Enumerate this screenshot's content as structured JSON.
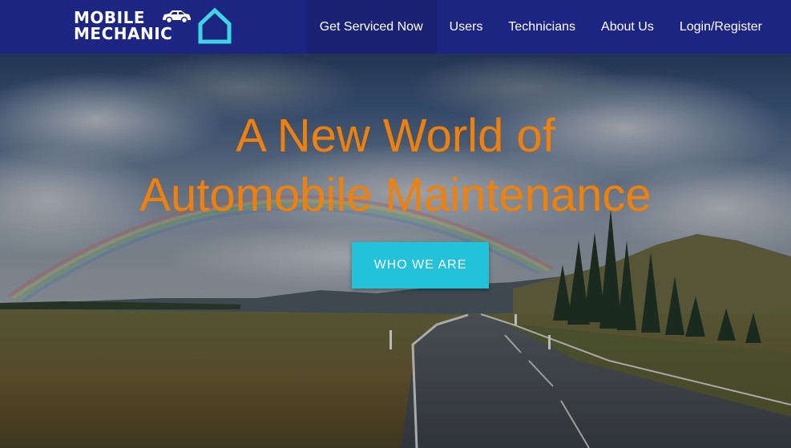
{
  "brand": {
    "line1": "MOBILE",
    "line2": "MECHANIC",
    "icons": [
      "car-icon",
      "house-icon"
    ]
  },
  "nav": {
    "items": [
      {
        "label": "Get Serviced Now",
        "active": true
      },
      {
        "label": "Users"
      },
      {
        "label": "Technicians"
      },
      {
        "label": "About Us"
      },
      {
        "label": "Login/Register"
      }
    ]
  },
  "hero": {
    "headline_line1": "A New World of",
    "headline_line2": "Automobile Maintenance",
    "cta_label": "WHO WE ARE"
  },
  "colors": {
    "navbar": "#1d2582",
    "navbar_active": "#1a2274",
    "headline": "#f0800c",
    "cta": "#22c2d8",
    "logo_house": "#3fd3e6"
  }
}
